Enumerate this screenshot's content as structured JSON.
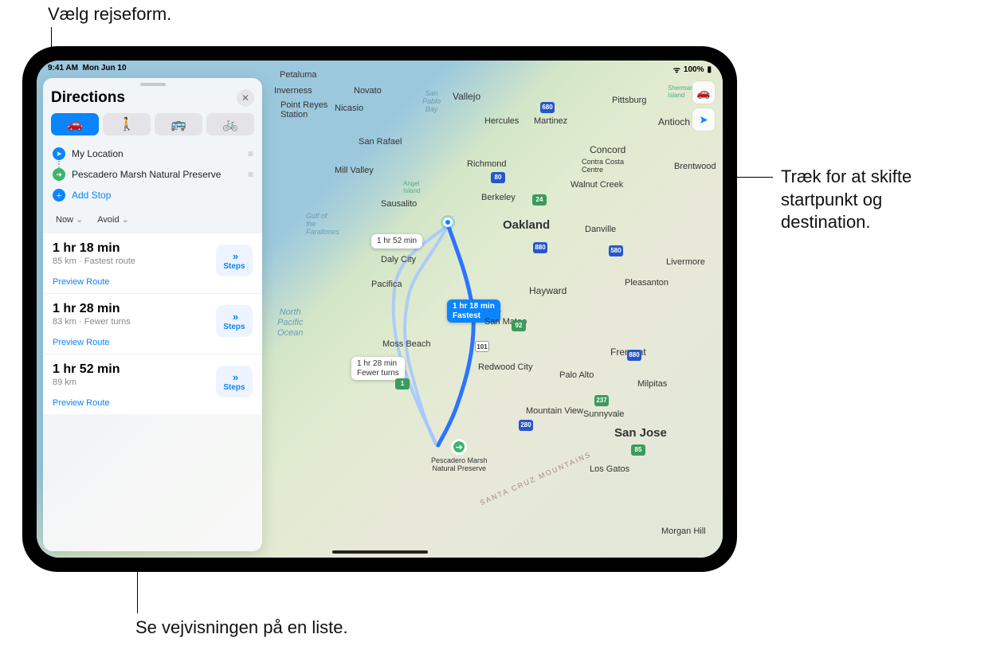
{
  "status": {
    "time": "9:41 AM",
    "date": "Mon Jun 10",
    "battery": "100%"
  },
  "panel": {
    "title": "Directions",
    "modes": [
      "drive",
      "walk",
      "transit",
      "cycle"
    ],
    "stops": {
      "from": "My Location",
      "to": "Pescadero Marsh Natural Preserve",
      "add": "Add Stop"
    },
    "options": {
      "now": "Now",
      "avoid": "Avoid"
    },
    "routes": [
      {
        "time": "1 hr 18 min",
        "sub": "85 km · Fastest route",
        "steps": "Steps",
        "preview": "Preview Route"
      },
      {
        "time": "1 hr 28 min",
        "sub": "83 km · Fewer turns",
        "steps": "Steps",
        "preview": "Preview Route"
      },
      {
        "time": "1 hr 52 min",
        "sub": "89 km",
        "steps": "Steps",
        "preview": "Preview Route"
      }
    ]
  },
  "map": {
    "ocean": "North\nPacific\nOcean",
    "destination": "Pescadero Marsh\nNatural Preserve",
    "callouts": {
      "main": {
        "line1": "1 hr 18 min",
        "line2": "Fastest"
      },
      "alt1": {
        "line1": "1 hr 28 min",
        "line2": "Fewer turns"
      },
      "alt2": "1 hr 52 min"
    },
    "cities": {
      "oakland": "Oakland",
      "sanjose": "San Jose",
      "fremont": "Fremont",
      "hayward": "Hayward",
      "berkeley": "Berkeley",
      "sanrafael": "San Rafael",
      "richmond": "Richmond",
      "dalycity": "Daly City",
      "pacifica": "Pacifica",
      "paloalto": "Palo Alto",
      "sunnyvale": "Sunnyvale",
      "mountainview": "Mountain View",
      "milpitas": "Milpitas",
      "livermore": "Livermore",
      "pleasanton": "Pleasanton",
      "walnutcreek": "Walnut Creek",
      "concord": "Concord",
      "antioch": "Antioch",
      "brentwood": "Brentwood",
      "vallejo": "Vallejo",
      "novato": "Novato",
      "danville": "Danville",
      "sanmateo": "San Mateo",
      "redwoodcity": "Redwood City",
      "mossbeach": "Moss Beach",
      "losgatos": "Los Gatos",
      "morganhill": "Morgan Hill",
      "sausalito": "Sausalito",
      "millvalley": "Mill Valley",
      "hercules": "Hercules",
      "martinez": "Martinez",
      "pittsburg": "Pittsburg",
      "petaluma": "Petaluma",
      "inverness": "Inverness",
      "pointreyes": "Point Reyes\nStation",
      "nicasio": "Nicasio",
      "gulfof": "Gulf of\nthe\nFarallones",
      "sanpablo": "San\nPablo\nBay",
      "angel": "Angel\nIsland",
      "sherman": "Sherman\nIsland",
      "contra": "Contra Costa\nCentre",
      "santacruz": "SANTA CRUZ MOUNTAINS"
    },
    "shields": {
      "i80": "80",
      "i580": "580",
      "i680": "680",
      "i880": "880",
      "i280": "280",
      "i101": "101",
      "c1": "1",
      "c92": "92",
      "c24": "24",
      "c237": "237",
      "c85": "85"
    }
  },
  "annotations": {
    "top": "Vælg rejseform.",
    "right": "Træk for at skifte startpunkt og destination.",
    "bottom": "Se vejvisningen på en liste."
  }
}
